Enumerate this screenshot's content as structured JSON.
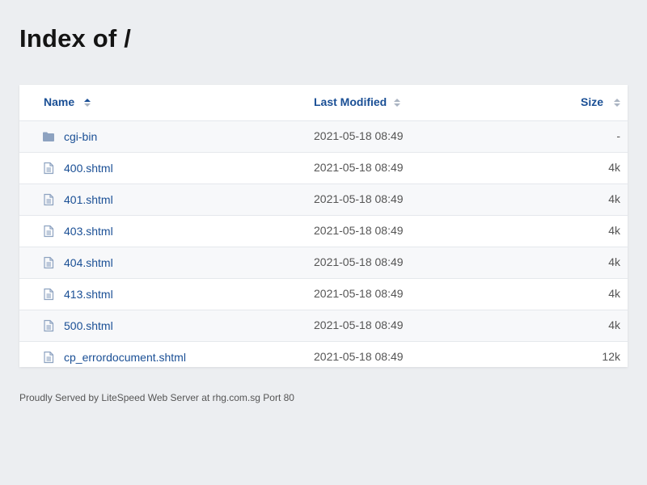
{
  "page": {
    "title": "Index of /"
  },
  "table": {
    "headers": {
      "name": "Name",
      "modified": "Last Modified",
      "size": "Size"
    },
    "rows": [
      {
        "name": "cgi-bin",
        "modified": "2021-05-18 08:49",
        "size": "-",
        "icon": "folder-icon"
      },
      {
        "name": "400.shtml",
        "modified": "2021-05-18 08:49",
        "size": "4k",
        "icon": "file-icon"
      },
      {
        "name": "401.shtml",
        "modified": "2021-05-18 08:49",
        "size": "4k",
        "icon": "file-icon"
      },
      {
        "name": "403.shtml",
        "modified": "2021-05-18 08:49",
        "size": "4k",
        "icon": "file-icon"
      },
      {
        "name": "404.shtml",
        "modified": "2021-05-18 08:49",
        "size": "4k",
        "icon": "file-icon"
      },
      {
        "name": "413.shtml",
        "modified": "2021-05-18 08:49",
        "size": "4k",
        "icon": "file-icon"
      },
      {
        "name": "500.shtml",
        "modified": "2021-05-18 08:49",
        "size": "4k",
        "icon": "file-icon"
      },
      {
        "name": "cp_errordocument.shtml",
        "modified": "2021-05-18 08:49",
        "size": "12k",
        "icon": "file-icon"
      }
    ]
  },
  "footer": {
    "text": "Proudly Served by LiteSpeed Web Server at rhg.com.sg Port 80"
  },
  "colors": {
    "background": "#eceef1",
    "link": "#1a4f95",
    "icon": "#8da2c0"
  }
}
